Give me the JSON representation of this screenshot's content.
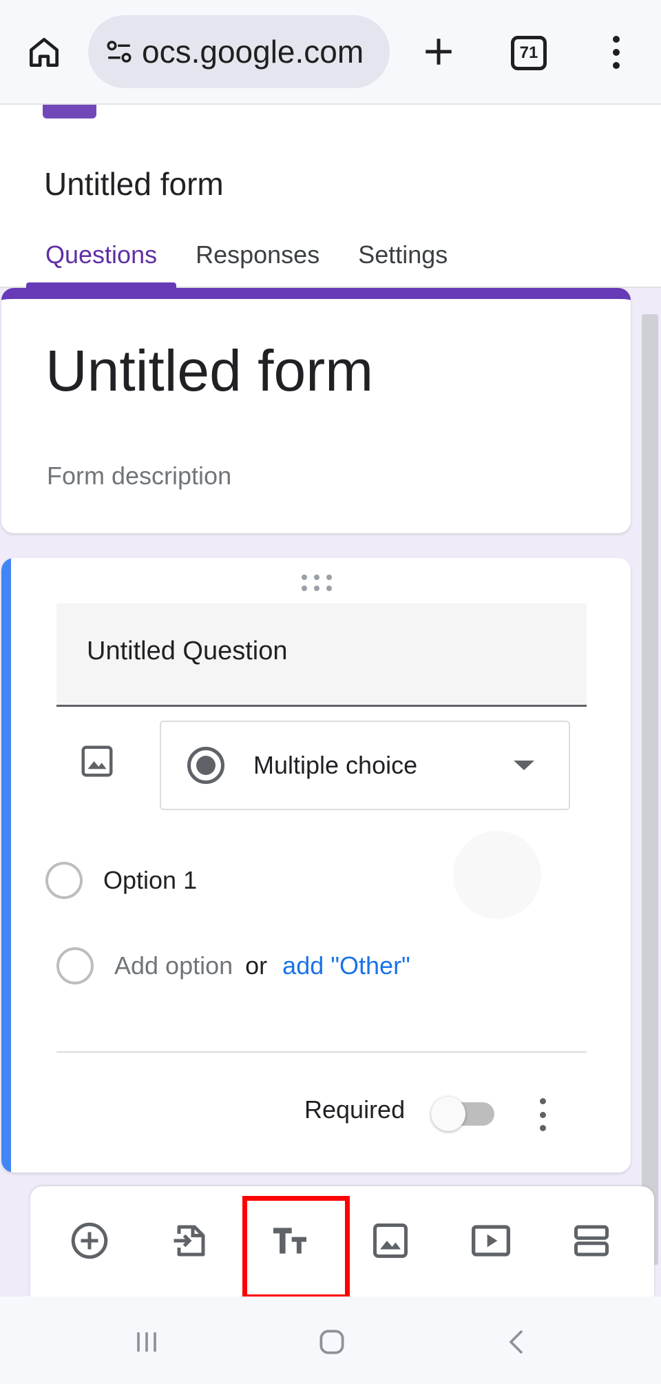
{
  "browser": {
    "url_display": "ocs.google.com",
    "tab_count": "71"
  },
  "forms_header": {
    "title": "Untitled form",
    "tabs": [
      {
        "label": "Questions",
        "active": true
      },
      {
        "label": "Responses",
        "active": false
      },
      {
        "label": "Settings",
        "active": false
      }
    ]
  },
  "form": {
    "title": "Untitled form",
    "description_placeholder": "Form description"
  },
  "question": {
    "title": "Untitled Question",
    "type": "Multiple choice",
    "options": [
      "Option 1"
    ],
    "add_option": "Add option",
    "or": "or",
    "add_other": "add \"Other\"",
    "required_label": "Required",
    "required": false
  },
  "toolbar": {
    "items": [
      "add-question-icon",
      "import-questions-icon",
      "add-title-description-icon",
      "add-image-icon",
      "add-video-icon",
      "add-section-icon"
    ],
    "highlighted": "add-title-description-icon"
  },
  "colors": {
    "forms_purple": "#673ab7",
    "question_accent": "#4285f4",
    "link_blue": "#1a73e8",
    "highlight_red": "#ff0000"
  }
}
